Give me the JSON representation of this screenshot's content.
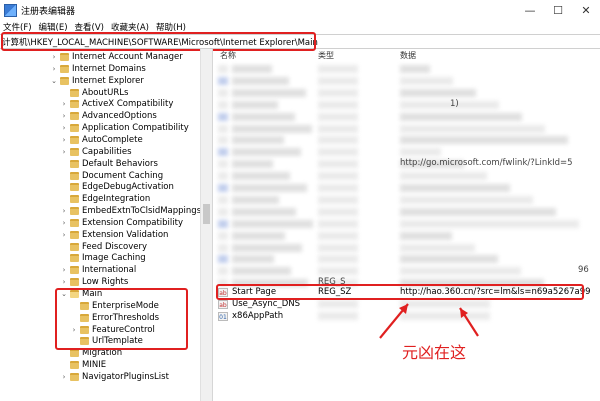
{
  "window": {
    "title": "注册表编辑器",
    "controls": [
      "—",
      "☐",
      "✕"
    ]
  },
  "menu": [
    "文件(F)",
    "编辑(E)",
    "查看(V)",
    "收藏夹(A)",
    "帮助(H)"
  ],
  "address": "计算机\\HKEY_LOCAL_MACHINE\\SOFTWARE\\Microsoft\\Internet Explorer\\Main",
  "tree": [
    {
      "label": "Internet Account Manager",
      "depth": 1,
      "arrow": ">"
    },
    {
      "label": "Internet Domains",
      "depth": 1,
      "arrow": ">"
    },
    {
      "label": "Internet Explorer",
      "depth": 1,
      "arrow": "v"
    },
    {
      "label": "AboutURLs",
      "depth": 2,
      "arrow": ""
    },
    {
      "label": "ActiveX Compatibility",
      "depth": 2,
      "arrow": ">"
    },
    {
      "label": "AdvancedOptions",
      "depth": 2,
      "arrow": ">"
    },
    {
      "label": "Application Compatibility",
      "depth": 2,
      "arrow": ">"
    },
    {
      "label": "AutoComplete",
      "depth": 2,
      "arrow": ">"
    },
    {
      "label": "Capabilities",
      "depth": 2,
      "arrow": ">"
    },
    {
      "label": "Default Behaviors",
      "depth": 2,
      "arrow": ""
    },
    {
      "label": "Document Caching",
      "depth": 2,
      "arrow": ""
    },
    {
      "label": "EdgeDebugActivation",
      "depth": 2,
      "arrow": ""
    },
    {
      "label": "EdgeIntegration",
      "depth": 2,
      "arrow": ""
    },
    {
      "label": "EmbedExtnToClsidMappings",
      "depth": 2,
      "arrow": ">"
    },
    {
      "label": "Extension Compatibility",
      "depth": 2,
      "arrow": ">"
    },
    {
      "label": "Extension Validation",
      "depth": 2,
      "arrow": ">"
    },
    {
      "label": "Feed Discovery",
      "depth": 2,
      "arrow": ""
    },
    {
      "label": "Image Caching",
      "depth": 2,
      "arrow": ""
    },
    {
      "label": "International",
      "depth": 2,
      "arrow": ">"
    },
    {
      "label": "Low Rights",
      "depth": 2,
      "arrow": ">"
    },
    {
      "label": "Main",
      "depth": 2,
      "arrow": "v",
      "open": true
    },
    {
      "label": "EnterpriseMode",
      "depth": 3,
      "arrow": ""
    },
    {
      "label": "ErrorThresholds",
      "depth": 3,
      "arrow": ""
    },
    {
      "label": "FeatureControl",
      "depth": 3,
      "arrow": ">"
    },
    {
      "label": "UrlTemplate",
      "depth": 3,
      "arrow": ""
    },
    {
      "label": "Migration",
      "depth": 2,
      "arrow": ""
    },
    {
      "label": "MINIE",
      "depth": 2,
      "arrow": ""
    },
    {
      "label": "NavigatorPluginsList",
      "depth": 2,
      "arrow": ">"
    }
  ],
  "columns": {
    "name": "名称",
    "type": "类型",
    "data": "数据"
  },
  "partial_values": [
    {
      "text": "1)",
      "row": 3
    },
    {
      "text": "http://go.microsoft.com/fwlink/?LinkId=5",
      "row": 8
    },
    {
      "text": "96",
      "row": 17
    },
    {
      "text": "REG_S",
      "row": 18
    }
  ],
  "values": [
    {
      "icon": "ab",
      "name": "Start Page",
      "type": "REG_SZ",
      "data": "http://hao.360.cn/?src=lm&ls=n69a5267a99"
    },
    {
      "icon": "ab",
      "name": "Use_Async_DNS",
      "type": "",
      "data": ""
    },
    {
      "icon": "01",
      "name": "x86AppPath",
      "type": "",
      "data": ""
    }
  ],
  "annotation": "元凶在这",
  "colors": {
    "highlight": "#e02020",
    "folder": "#e8c262"
  }
}
